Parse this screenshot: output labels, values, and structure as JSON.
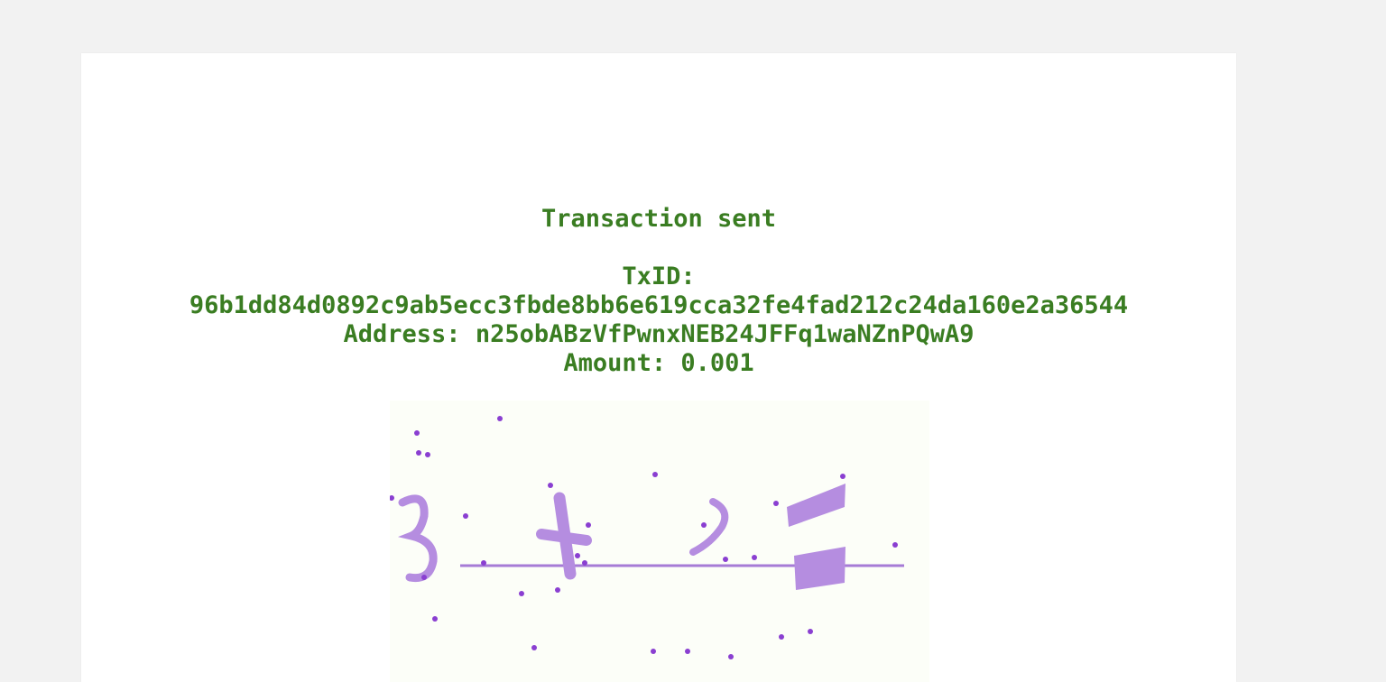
{
  "result": {
    "title": "Transaction sent",
    "txid_label": "TxID:",
    "txid": "96b1dd84d0892c9ab5ecc3fbde8bb6e619cca32fe4fad212c24da160e2a36544",
    "address_label": "Address:",
    "address": "n25obABzVfPwnxNEB24JFFq1waNZnPQwA9",
    "amount_label": "Amount:",
    "amount": "0.001"
  },
  "captcha": {
    "ink_color": "#a67bd6",
    "dot_color": "#8a3fd1",
    "background": "#fcfef8",
    "text": "3+?="
  },
  "colors": {
    "text": "#3a7d22",
    "page_background": "#f2f2f2",
    "card_background": "#ffffff"
  }
}
